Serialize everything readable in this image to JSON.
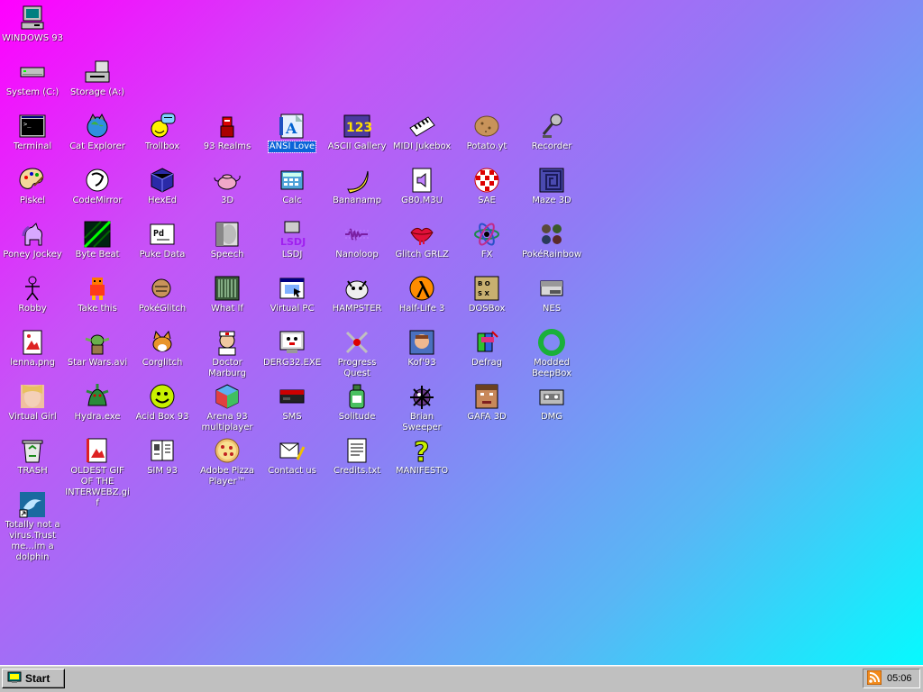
{
  "desktop": {
    "selected_icon": "ANSI Love",
    "icons": [
      {
        "label": "WINDOWS 93",
        "icon": "computer-icon"
      },
      {
        "label": "System (C:)",
        "icon": "hard-drive-icon"
      },
      {
        "label": "Storage (A:)",
        "icon": "floppy-drive-icon"
      },
      {
        "label": "Terminal",
        "icon": "terminal-icon"
      },
      {
        "label": "Cat Explorer",
        "icon": "cat-globe-icon"
      },
      {
        "label": "Trollbox",
        "icon": "trollface-chat-icon"
      },
      {
        "label": "93 Realms",
        "icon": "knight-icon"
      },
      {
        "label": "ANSI Love",
        "icon": "ansi-letter-icon"
      },
      {
        "label": "ASCII Gallery",
        "icon": "ascii-123-icon"
      },
      {
        "label": "MIDI Jukebox",
        "icon": "piano-keys-icon"
      },
      {
        "label": "Potato.yt",
        "icon": "potato-icon"
      },
      {
        "label": "Recorder",
        "icon": "microphone-icon"
      },
      {
        "label": "Piskel",
        "icon": "paint-palette-icon"
      },
      {
        "label": "CodeMirror",
        "icon": "codemirror-icon"
      },
      {
        "label": "HexEd",
        "icon": "cube-icon"
      },
      {
        "label": "3D",
        "icon": "teapot-icon"
      },
      {
        "label": "Calc",
        "icon": "calculator-icon"
      },
      {
        "label": "Bananamp",
        "icon": "banana-icon"
      },
      {
        "label": "G80.M3U",
        "icon": "speaker-file-icon"
      },
      {
        "label": "SAE",
        "icon": "checkered-ball-icon"
      },
      {
        "label": "Maze 3D",
        "icon": "maze-icon"
      },
      {
        "label": "Poney Jockey",
        "icon": "pony-icon"
      },
      {
        "label": "Byte Beat",
        "icon": "bytebeat-icon"
      },
      {
        "label": "Puke Data",
        "icon": "puredata-icon"
      },
      {
        "label": "Speech",
        "icon": "speech-face-icon"
      },
      {
        "label": "LSDJ",
        "icon": "lsdj-icon"
      },
      {
        "label": "Nanoloop",
        "icon": "waveform-icon"
      },
      {
        "label": "Glitch GRLZ",
        "icon": "lips-icon"
      },
      {
        "label": "FX",
        "icon": "atom-icon"
      },
      {
        "label": "PokéRainbow",
        "icon": "trainers-icon"
      },
      {
        "label": "Robby",
        "icon": "stick-figure-icon"
      },
      {
        "label": "Take this",
        "icon": "pixel-man-icon"
      },
      {
        "label": "PokéGlitch",
        "icon": "glitch-creature-icon"
      },
      {
        "label": "What If",
        "icon": "barcode-screen-icon"
      },
      {
        "label": "Virtual PC",
        "icon": "window-cursor-icon"
      },
      {
        "label": "HAMPSTER",
        "icon": "hamster-icon"
      },
      {
        "label": "Half-Life 3",
        "icon": "lambda-icon"
      },
      {
        "label": "DOSBox",
        "icon": "dosbox-icon"
      },
      {
        "label": "NES",
        "icon": "nes-console-icon"
      },
      {
        "label": "lenna.png",
        "icon": "image-file-icon"
      },
      {
        "label": "Star Wars.avi",
        "icon": "yoda-icon"
      },
      {
        "label": "Corglitch",
        "icon": "corgi-icon"
      },
      {
        "label": "Doctor Marburg",
        "icon": "doctor-icon"
      },
      {
        "label": "DERG32.EXE",
        "icon": "derg-monitor-icon"
      },
      {
        "label": "Progress Quest",
        "icon": "crossed-swords-icon"
      },
      {
        "label": "Kof'93",
        "icon": "fighter-portrait-icon"
      },
      {
        "label": "Defrag",
        "icon": "defrag-icon"
      },
      {
        "label": "Modded BeepBox",
        "icon": "green-ring-icon"
      },
      {
        "label": "Virtual Girl",
        "icon": "girl-face-icon"
      },
      {
        "label": "Hydra.exe",
        "icon": "hydra-icon"
      },
      {
        "label": "Acid Box 93",
        "icon": "acid-smiley-icon"
      },
      {
        "label": "Arena 93 multiplayer",
        "icon": "arena-cube-icon"
      },
      {
        "label": "SMS",
        "icon": "master-system-icon"
      },
      {
        "label": "Solitude",
        "icon": "bottle-icon"
      },
      {
        "label": "Brian Sweeper",
        "icon": "mine-icon"
      },
      {
        "label": "GAFA 3D",
        "icon": "doom-face-icon"
      },
      {
        "label": "DMG",
        "icon": "cassette-icon"
      },
      {
        "label": "TRASH",
        "icon": "recycle-bin-icon"
      },
      {
        "label": "OLDEST GIF OF THE INTERWEBZ.gif",
        "icon": "gif-file-icon"
      },
      {
        "label": "SIM 93",
        "icon": "sim-book-icon"
      },
      {
        "label": "Adobe Pizza Player™",
        "icon": "pizza-icon"
      },
      {
        "label": "Contact us",
        "icon": "letter-pencil-icon"
      },
      {
        "label": "Credits.txt",
        "icon": "text-file-icon"
      },
      {
        "label": "MANIFESTO",
        "icon": "question-mark-icon"
      },
      {
        "label": "Totally not a virus.Trust me...im a dolphin",
        "icon": "dolphin-shortcut-icon"
      }
    ]
  },
  "taskbar": {
    "start_label": "Start",
    "clock": "05:06",
    "tray_icon": "rss-feed-icon"
  }
}
